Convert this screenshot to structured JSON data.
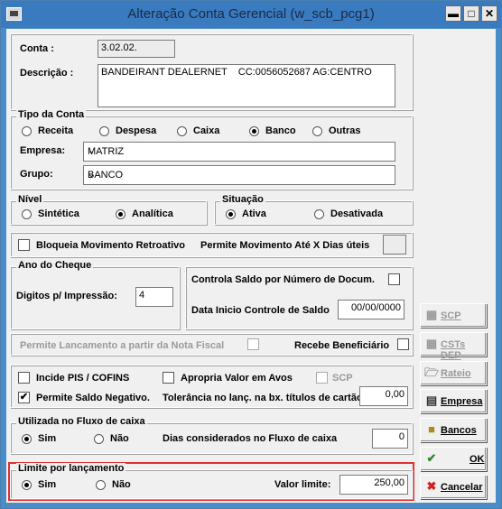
{
  "window": {
    "title": "Alteração Conta Gerencial (w_scb_pcg1)",
    "minimize": "▬",
    "maximize": "□",
    "close": "✕"
  },
  "conta": {
    "label": "Conta :",
    "value": "3.02.02."
  },
  "descricao": {
    "label": "Descrição :",
    "value": "BANDEIRANT DEALERNET    CC:0056052687 AG:CENTRO"
  },
  "tipo_conta": {
    "legend": "Tipo da Conta",
    "options": [
      {
        "label": "Receita",
        "selected": false
      },
      {
        "label": "Despesa",
        "selected": false
      },
      {
        "label": "Caixa",
        "selected": false
      },
      {
        "label": "Banco",
        "selected": true
      },
      {
        "label": "Outras",
        "selected": false
      }
    ],
    "empresa_label": "Empresa:",
    "empresa_value": "MATRIZ",
    "grupo_label": "Grupo:",
    "grupo_value": "BANCO"
  },
  "nivel": {
    "legend": "Nível",
    "sintetica": "Sintética",
    "analitica": "Analítica",
    "selected": "Analítica"
  },
  "situacao": {
    "legend": "Situação",
    "ativa": "Ativa",
    "desativada": "Desativada",
    "selected": "Ativa"
  },
  "bloqueia": {
    "label": "Bloqueia Movimento Retroativo",
    "checked": false,
    "permite_label": "Permite Movimento Até X Dias úteis",
    "dias_value": ""
  },
  "ano_cheque": {
    "legend": "Ano do Cheque",
    "digitos_label": "Digitos p/ Impressão:",
    "digitos_value": "4"
  },
  "controla": {
    "label": "Controla  Saldo por Número de Docum.",
    "checked": false,
    "data_label": "Data Inicio Controle de Saldo",
    "data_value": "00/00/0000"
  },
  "nota_fiscal": {
    "label": "Permite Lancamento a partir da Nota Fiscal",
    "recebe_label": "Recebe Beneficiário"
  },
  "pis": {
    "incide_label": "Incide PIS / COFINS",
    "incide_checked": false,
    "apropria_label": "Apropria Valor em Avos",
    "apropria_checked": false,
    "scp_label": "SCP",
    "saldo_neg_label": "Permite Saldo Negativo.",
    "saldo_neg_checked": true,
    "tolerancia_label": "Tolerância no lanç. na bx. títulos de cartão:",
    "tolerancia_value": "0,00"
  },
  "fluxo": {
    "legend": "Utilizada no Fluxo de caixa",
    "sim": "Sim",
    "nao": "Não",
    "selected": "Sim",
    "dias_label": "Dias considerados no Fluxo de caixa",
    "dias_value": "0"
  },
  "limite": {
    "legend": "Limite por lançamento",
    "sim": "Sim",
    "nao": "Não",
    "selected": "Sim",
    "valor_label": "Valor limite:",
    "valor_value": "250,00"
  },
  "buttons": {
    "scp": "SCP",
    "csts_dep": "CSTs DEP",
    "rateio": "Rateio",
    "empresa": "Empresa",
    "bancos": "Bancos",
    "ok": "OK",
    "cancelar": "Cancelar"
  },
  "colors": {
    "titlebar": "#3a7bc0",
    "highlight": "#e03030",
    "background": "#f0f0f0"
  }
}
